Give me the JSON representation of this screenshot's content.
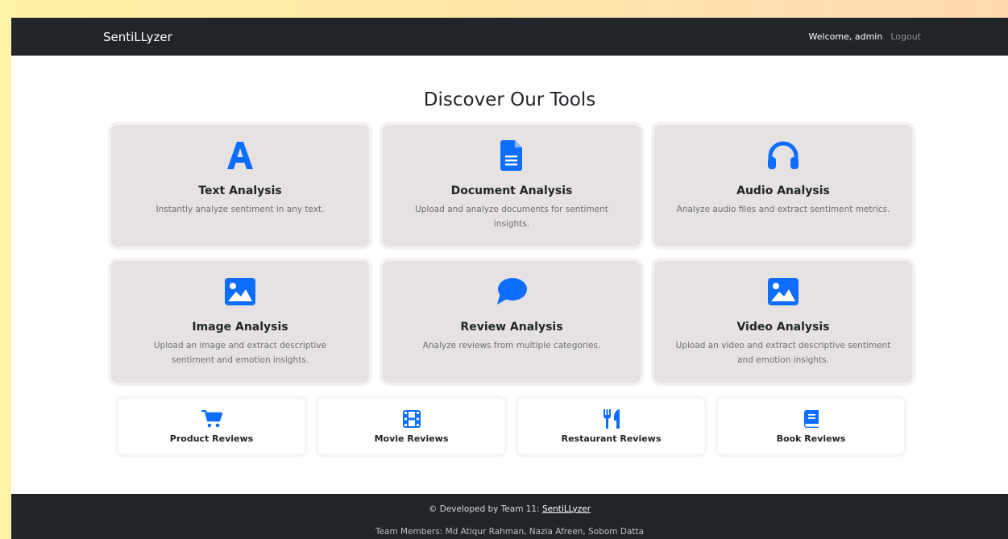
{
  "navbar": {
    "brand": "SentiLLyzer",
    "welcome": "Welcome, admin",
    "logout": "Logout"
  },
  "heading": "Discover Our Tools",
  "tools": [
    {
      "icon": "letter-a-icon",
      "title": "Text Analysis",
      "desc": "Instantly analyze sentiment in any text."
    },
    {
      "icon": "document-icon",
      "title": "Document Analysis",
      "desc": "Upload and analyze documents for sentiment insights."
    },
    {
      "icon": "headphones-icon",
      "title": "Audio Analysis",
      "desc": "Analyze audio files and extract sentiment metrics."
    },
    {
      "icon": "image-icon",
      "title": "Image Analysis",
      "desc": "Upload an image and extract descriptive sentiment and emotion insights."
    },
    {
      "icon": "chat-bubble-icon",
      "title": "Review Analysis",
      "desc": "Analyze reviews from multiple categories."
    },
    {
      "icon": "image-icon",
      "title": "Video Analysis",
      "desc": "Upload an video and extract descriptive sentiment and emotion insights."
    }
  ],
  "reviews": [
    {
      "icon": "cart-icon",
      "label": "Product Reviews"
    },
    {
      "icon": "film-icon",
      "label": "Movie Reviews"
    },
    {
      "icon": "utensils-icon",
      "label": "Restaurant Reviews"
    },
    {
      "icon": "book-icon",
      "label": "Book Reviews"
    }
  ],
  "footer": {
    "prefix": "© Developed by Team 11: ",
    "link": "SentiLLyzer",
    "members": "Team Members: Md Atiqur Rahman, Nazia Afreen, Sobom Datta"
  },
  "colors": {
    "accent": "#0d6efd",
    "navbar": "#212529",
    "card": "#e5e2e1"
  }
}
